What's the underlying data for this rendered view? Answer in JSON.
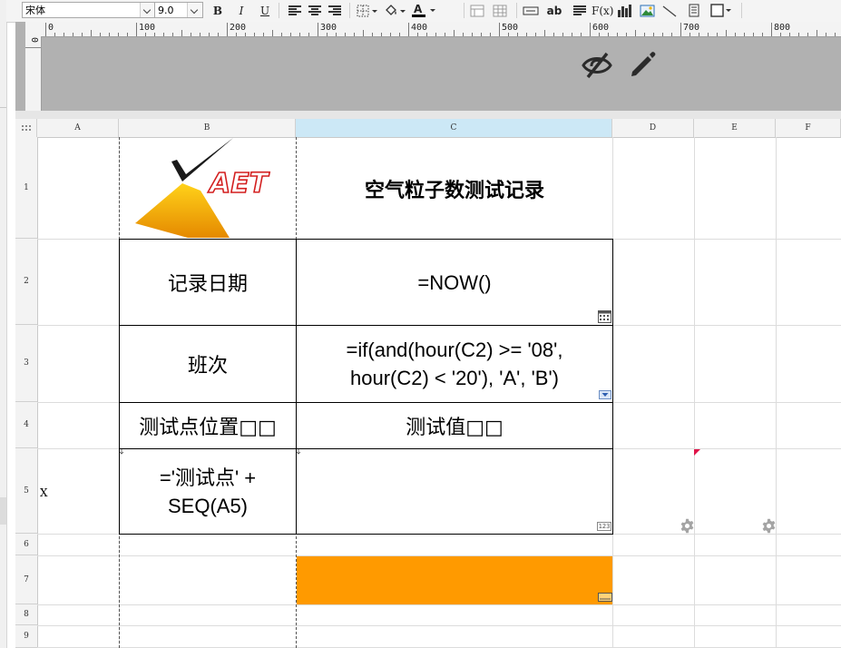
{
  "toolbar": {
    "font_name": "宋体",
    "font_size": "9.0",
    "bold_label": "B",
    "italic_label": "I",
    "underline_label": "U",
    "text_color": "#000000",
    "ab_label": "ab",
    "fx_label": "F(x)"
  },
  "ruler": {
    "h_ticks": [
      "0",
      "100",
      "200",
      "300",
      "400",
      "500",
      "600",
      "700",
      "800"
    ],
    "v_zero": "0"
  },
  "sheet": {
    "columns": [
      {
        "label": "A",
        "selected": false
      },
      {
        "label": "B",
        "selected": false
      },
      {
        "label": "C",
        "selected": true
      },
      {
        "label": "D",
        "selected": false
      },
      {
        "label": "E",
        "selected": false
      },
      {
        "label": "F",
        "selected": false
      }
    ],
    "rows": [
      "1",
      "2",
      "3",
      "4",
      "5",
      "6",
      "7",
      "8",
      "9"
    ]
  },
  "cells": {
    "logo_text": "AET",
    "title": "空气粒子数测试记录",
    "record_date_label": "记录日期",
    "record_date_formula": "=NOW()",
    "shift_label": "班次",
    "shift_formula_line1": "=if(and(hour(C2) >= '08',",
    "shift_formula_line2": "hour(C2) < '20'), 'A', 'B')",
    "point_label": "测试点位置□□",
    "value_label": "测试值□□",
    "point_formula_line1": "='测试点' +",
    "point_formula_line2": "SEQ(A5)",
    "a5_value": "X",
    "numeric_badge": "123"
  },
  "colors": {
    "orange_fill": "#ff9a00",
    "selected_column": "#cce8f6",
    "band_grey": "#b1b1b1"
  },
  "icons": {
    "visibility": "eye-off-icon",
    "edit": "pencil-icon",
    "settings": "gear-icon"
  }
}
